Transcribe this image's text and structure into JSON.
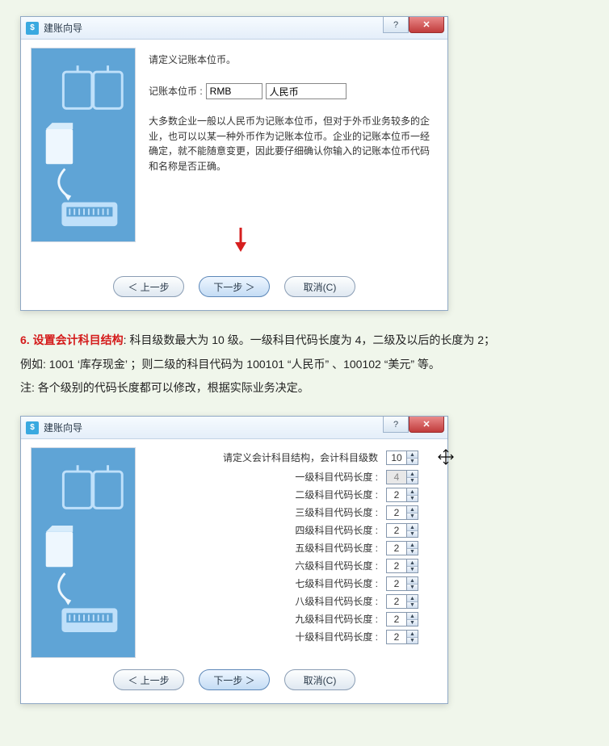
{
  "dialog1": {
    "title": "建账向导",
    "heading": "请定义记账本位币。",
    "currency_label": "记账本位币 :",
    "code": "RMB",
    "name": "人民币",
    "description": "大多数企业一般以人民币为记账本位币，但对于外币业务较多的企业，也可以以某一种外币作为记账本位币。企业的记账本位币一经确定，就不能随意变更，因此要仔细确认你输入的记账本位币代码和名称是否正确。",
    "btn_back": "＜ 上一步",
    "btn_next": "下一步  ＞",
    "btn_cancel": "取消(C)"
  },
  "article": {
    "step_title": "6. 设置会计科目结构",
    "line1_rest": ":  科目级数最大为 10 级。一级科目代码长度为 4，二级及以后的长度为 2；",
    "line2": "例如: 1001 ‘库存现金’ ；则二级的科目代码为 100101 “人民币” 、100102 “美元” 等。",
    "line3": "注: 各个级别的代码长度都可以修改，根据实际业务决定。"
  },
  "dialog2": {
    "title": "建账向导",
    "heading": "请定义会计科目结构，会计科目级数",
    "level_count": 10,
    "levels": [
      {
        "label": "一级科目代码长度 :",
        "value": 4,
        "disabled": true
      },
      {
        "label": "二级科目代码长度 :",
        "value": 2,
        "disabled": false
      },
      {
        "label": "三级科目代码长度 :",
        "value": 2,
        "disabled": false
      },
      {
        "label": "四级科目代码长度 :",
        "value": 2,
        "disabled": false
      },
      {
        "label": "五级科目代码长度 :",
        "value": 2,
        "disabled": false
      },
      {
        "label": "六级科目代码长度 :",
        "value": 2,
        "disabled": false
      },
      {
        "label": "七级科目代码长度 :",
        "value": 2,
        "disabled": false
      },
      {
        "label": "八级科目代码长度 :",
        "value": 2,
        "disabled": false
      },
      {
        "label": "九级科目代码长度 :",
        "value": 2,
        "disabled": false
      },
      {
        "label": "十级科目代码长度 :",
        "value": 2,
        "disabled": false
      }
    ],
    "btn_back": "＜ 上一步",
    "btn_next": "下一步  ＞",
    "btn_cancel": "取消(C)"
  }
}
